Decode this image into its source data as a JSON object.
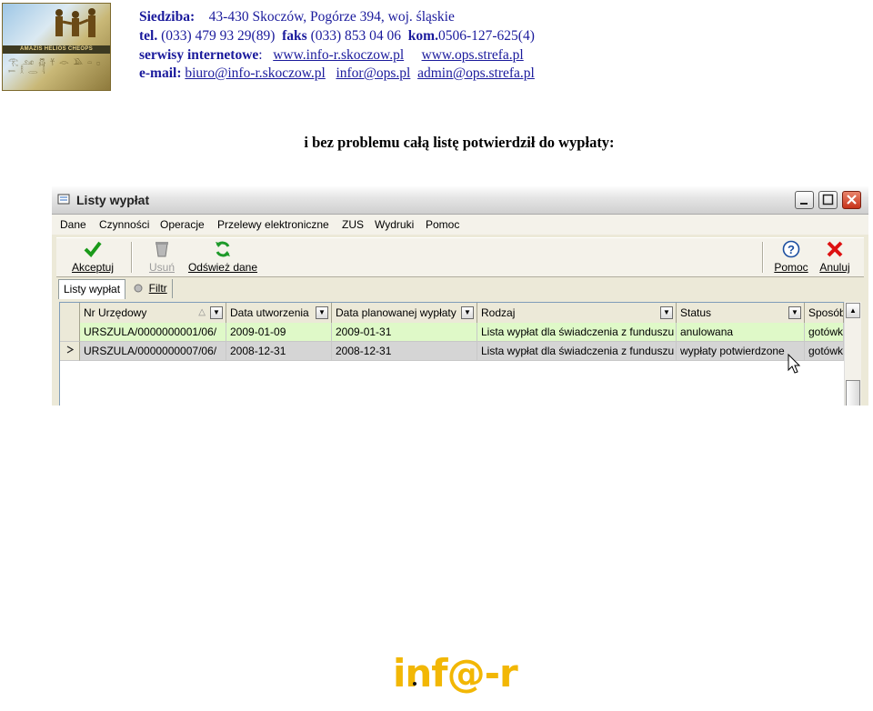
{
  "logo": {
    "band_text": "AMAZIS HELIOS CHEOPS",
    "glyphs": "𓂀 𓃭 𓆣 𓋹 𓁹 𓅓 𓏏 𓊪 𓍿 𓎛 𓂋 𓇋"
  },
  "header": {
    "seat_label": "Siedziba:",
    "address": "43-430 Skoczów,  Pogórze 394,  woj. śląskie",
    "tel_label": "tel.",
    "tel": "(033) 479 93 29(89)",
    "fax_label": "faks",
    "fax": "(033) 853 04 06",
    "mobile_label": "kom.",
    "mobile": "0506-127-625(4)",
    "web_label": "serwisy internetowe",
    "web_colon": ":",
    "web1": "www.info-r.skoczow.pl",
    "web2": "www.ops.strefa.pl",
    "email_label": "e-mail:",
    "email1": "biuro@info-r.skoczow.pl",
    "email2": "infor@ops.pl",
    "email3": "admin@ops.strefa.pl"
  },
  "caption": "i bez problemu całą listę potwierdził do wypłaty:",
  "window": {
    "title": "Listy wypłat",
    "menu": [
      "Dane",
      "Czynności",
      "Operacje",
      "Przelewy elektroniczne",
      "ZUS",
      "Wydruki",
      "Pomoc"
    ],
    "toolbar": {
      "accept": "Akceptuj",
      "delete": "Usuń",
      "refresh": "Odśwież dane",
      "help": "Pomoc",
      "cancel": "Anuluj"
    },
    "tabs": {
      "lists": "Listy wypłat",
      "filter": "Filtr"
    },
    "grid": {
      "columns": [
        "Nr Urzędowy",
        "Data utworzenia",
        "Data planowanej wypłaty",
        "Rodzaj",
        "Status",
        "Sposób"
      ],
      "rows": [
        {
          "nr": "URSZULA/0000000001/06/",
          "created": "2009-01-09",
          "planned": "2009-01-31",
          "kind": "Lista wypłat dla świadczenia z funduszu",
          "status": "anulowana",
          "method": "gotówk"
        },
        {
          "nr": "URSZULA/0000000007/06/",
          "created": "2008-12-31",
          "planned": "2008-12-31",
          "kind": "Lista wypłat dla świadczenia z funduszu",
          "status": "wypłaty potwierdzone",
          "method": "gotówk"
        }
      ],
      "row_colors": {
        "row1": "#dff9c8",
        "row2": "#d5d5d5"
      }
    }
  },
  "footer": {
    "logo_text": "inf@-r"
  },
  "colors": {
    "header_text": "#1a1a9c",
    "footer_logo": "#f2b705"
  }
}
